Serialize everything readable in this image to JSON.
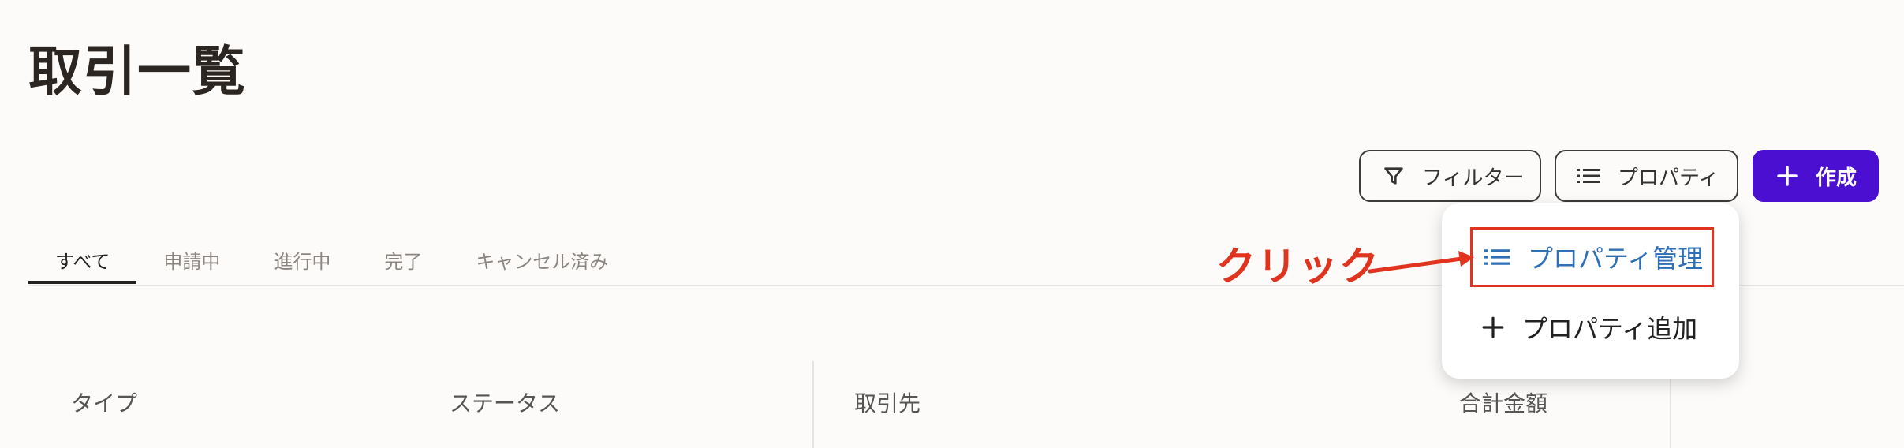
{
  "page": {
    "title": "取引一覧"
  },
  "toolbar": {
    "filter_label": "フィルター",
    "property_label": "プロパティ",
    "create_label": "作成",
    "filter_icon": "filter-icon",
    "property_icon": "list-icon",
    "create_icon": "plus-icon"
  },
  "tabs": [
    {
      "label": "すべて",
      "active": true
    },
    {
      "label": "申請中",
      "active": false
    },
    {
      "label": "進行中",
      "active": false
    },
    {
      "label": "完了",
      "active": false
    },
    {
      "label": "キャンセル済み",
      "active": false
    }
  ],
  "table": {
    "columns": [
      "タイプ",
      "ステータス",
      "取引先",
      "合計金額"
    ]
  },
  "property_menu": {
    "items": [
      {
        "label": "プロパティ管理",
        "icon": "list-icon",
        "highlighted": true
      },
      {
        "label": "プロパティ追加",
        "icon": "plus-icon",
        "highlighted": false
      }
    ]
  },
  "annotation": {
    "text": "クリック",
    "color": "#e0341f"
  },
  "colors": {
    "accent": "#4a0fd1",
    "link": "#2f6fb6",
    "annotation": "#e0341f",
    "background": "#fcfbf9"
  }
}
